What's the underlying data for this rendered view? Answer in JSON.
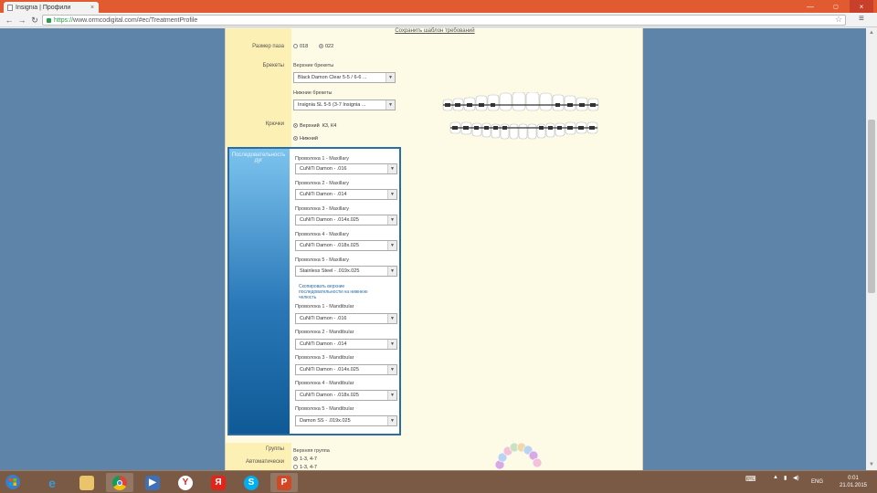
{
  "browser": {
    "tab_title": "Insignia | Профили",
    "tab_close": "×",
    "url_scheme": "https://",
    "url_rest": "www.ormcodigital.com/#ec/TreatmentProfile",
    "minimize": "—",
    "close": "×"
  },
  "page": {
    "header_link": "Сохранить шаблон требований",
    "slot_size": {
      "label": "Размер паза",
      "options": [
        "018",
        "022"
      ],
      "selected": "022"
    },
    "brackets": {
      "label": "Брекеты",
      "upper_label": "Верхние брекеты",
      "upper_value": "Black Damon Clear 5-5 / 6-6 ...",
      "lower_label": "Нижние брекеты",
      "lower_value": "Insignia SL 5-5 (3-7 Insignia ..."
    },
    "hooks": {
      "label": "Крючки",
      "upper": "Верхний",
      "upper_detail": "К3, К4",
      "lower": "Нижний"
    },
    "wires": {
      "side_label": "Последовательность дуг",
      "maxillary": [
        {
          "label": "Проволока 1 - Maxillary",
          "value": "CuNiTi Damon - .016"
        },
        {
          "label": "Проволока 2 - Maxillary",
          "value": "CuNiTi Damon - .014"
        },
        {
          "label": "Проволока 3 - Maxillary",
          "value": "CuNiTi Damon - .014x.025"
        },
        {
          "label": "Проволока 4 - Maxillary",
          "value": "CuNiTi Damon - .018x.025"
        },
        {
          "label": "Проволока 5 - Maxillary",
          "value": "Stainless Steel - .019x.025"
        }
      ],
      "copy_note": "Скопировать верхние последовательности на нижнюю челюсть",
      "mandibular": [
        {
          "label": "Проволока 1 - Mandibular",
          "value": "CuNiTi Damon - .016"
        },
        {
          "label": "Проволока 2 - Mandibular",
          "value": "CuNiTi Damon - .014"
        },
        {
          "label": "Проволока 3 - Mandibular",
          "value": "CuNiTi Damon - .014x.025"
        },
        {
          "label": "Проволока 4 - Mandibular",
          "value": "CuNiTi Damon - .018x.025"
        },
        {
          "label": "Проволока 5 - Mandibular",
          "value": "Damon SS - .019x.025"
        }
      ]
    },
    "groups": {
      "label": "Группы",
      "sublabel": "Автоматически",
      "upper_label": "Верхняя группа",
      "opt1": "1-3, 4-7",
      "opt2": "1-3, 4-7"
    }
  },
  "taskbar": {
    "lang": "ENG",
    "time": "0:01",
    "date": "21.01.2015"
  },
  "colors": {
    "accent": "#2a6ea6",
    "titlebar": "#e25a2f",
    "panel_bg": "#fdfbe6"
  }
}
